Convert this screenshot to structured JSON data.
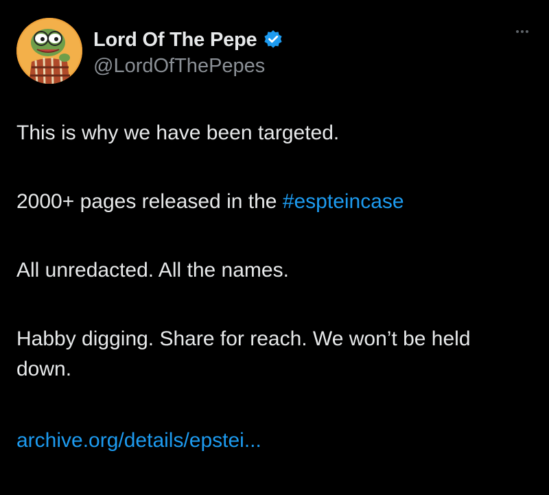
{
  "author": {
    "display_name": "Lord Of The Pepe",
    "handle": "@LordOfThePepes",
    "verified": true,
    "avatar_icon": "pepe-avatar-icon"
  },
  "menu": {
    "icon": "more-options-icon"
  },
  "post": {
    "line1": "This is why we have been targeted.",
    "line2_prefix": "2000+ pages released in the ",
    "line2_hashtag": "#espteincase",
    "line3": "All unredacted. All the names.",
    "line4": "Habby digging. Share for reach. We won’t be held down.",
    "link": "archive.org/details/epstei..."
  },
  "colors": {
    "background": "#000000",
    "text": "#e7e9ea",
    "secondary_text": "#8b9096",
    "link": "#1d9bf0",
    "verified_badge": "#1d9bf0"
  }
}
